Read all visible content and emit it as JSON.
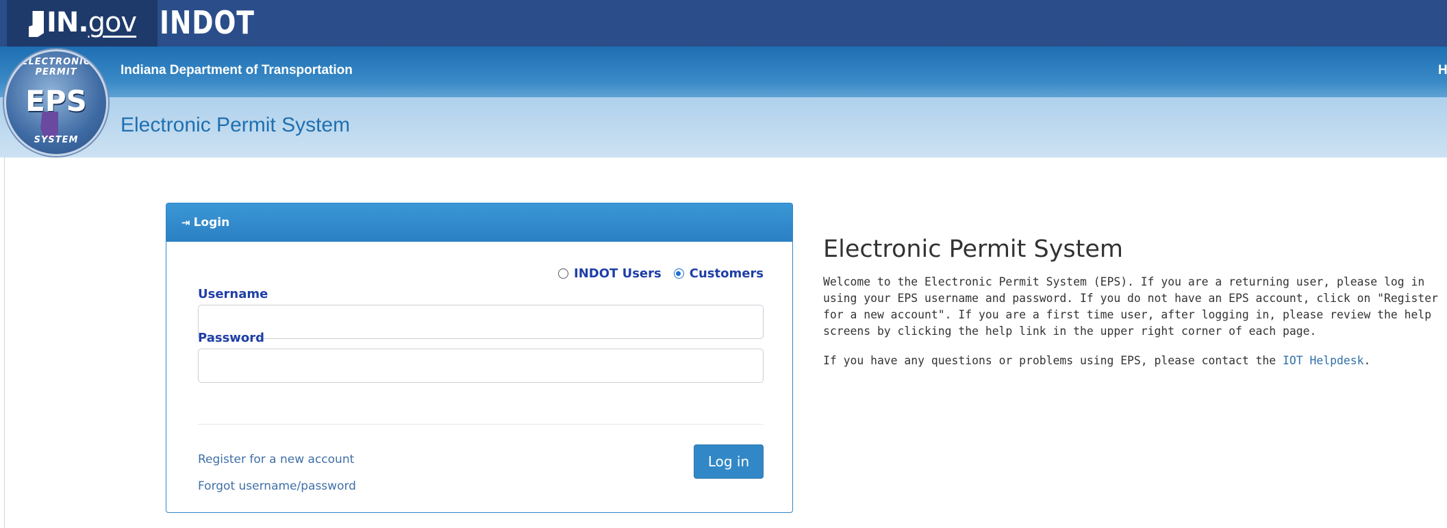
{
  "top_bar": {
    "ingov_logo": {
      "prefix": "IN.",
      "suffix": "gov"
    },
    "agency": "INDOT"
  },
  "header": {
    "seal": {
      "ring_top": "ELECTRONIC PERMIT",
      "center": "EPS",
      "ring_bottom": "SYSTEM"
    },
    "department": "Indiana Department of Transportation",
    "system_name": "Electronic Permit System",
    "right_link": "H"
  },
  "login": {
    "title": "Login",
    "user_types": [
      {
        "label": "INDOT Users",
        "selected": false
      },
      {
        "label": "Customers",
        "selected": true
      }
    ],
    "username_label": "Username",
    "username_value": "",
    "password_label": "Password",
    "password_value": "",
    "register_link": "Register for a new account",
    "forgot_link": "Forgot username/password",
    "submit_label": "Log in"
  },
  "content": {
    "title": "Electronic Permit System",
    "paragraph1": "Welcome to the Electronic Permit System (EPS). If you are a returning user, please log in using your EPS username and password. If you do not have an EPS account, click on \"Register for a new account\". If you are a first time user, after logging in, please review the help screens by clicking the help link in the upper right corner of each page.",
    "paragraph2_text": "If you have any questions or problems using EPS, please contact the ",
    "paragraph2_link": "IOT Helpdesk",
    "paragraph2_end": "."
  },
  "colors": {
    "top_bar": "#2b4e8a",
    "header_dark": "#1e6fb3",
    "header_light": "#bcd8ee",
    "panel_header": "#2a80c3",
    "label_text": "#1f3fa6",
    "link": "#3f6fa6",
    "button": "#3288c6"
  }
}
